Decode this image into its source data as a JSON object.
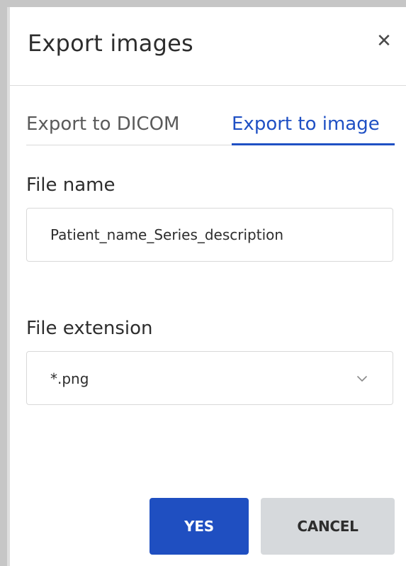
{
  "dialog": {
    "title": "Export images",
    "close_icon": "close-icon"
  },
  "tabs": [
    {
      "label": "Export to DICOM",
      "active": false
    },
    {
      "label": "Export to image",
      "active": true
    }
  ],
  "form": {
    "file_name": {
      "label": "File name",
      "value": "Patient_name_Series_description"
    },
    "file_extension": {
      "label": "File extension",
      "selected": "*.png",
      "icon": "chevron-down-icon"
    }
  },
  "actions": {
    "yes_label": "YES",
    "cancel_label": "CANCEL"
  },
  "colors": {
    "accent": "#1f50c4",
    "primary_button": "#1f4fc1",
    "secondary_button": "#d6d9dc",
    "text": "#2d2d2d"
  }
}
